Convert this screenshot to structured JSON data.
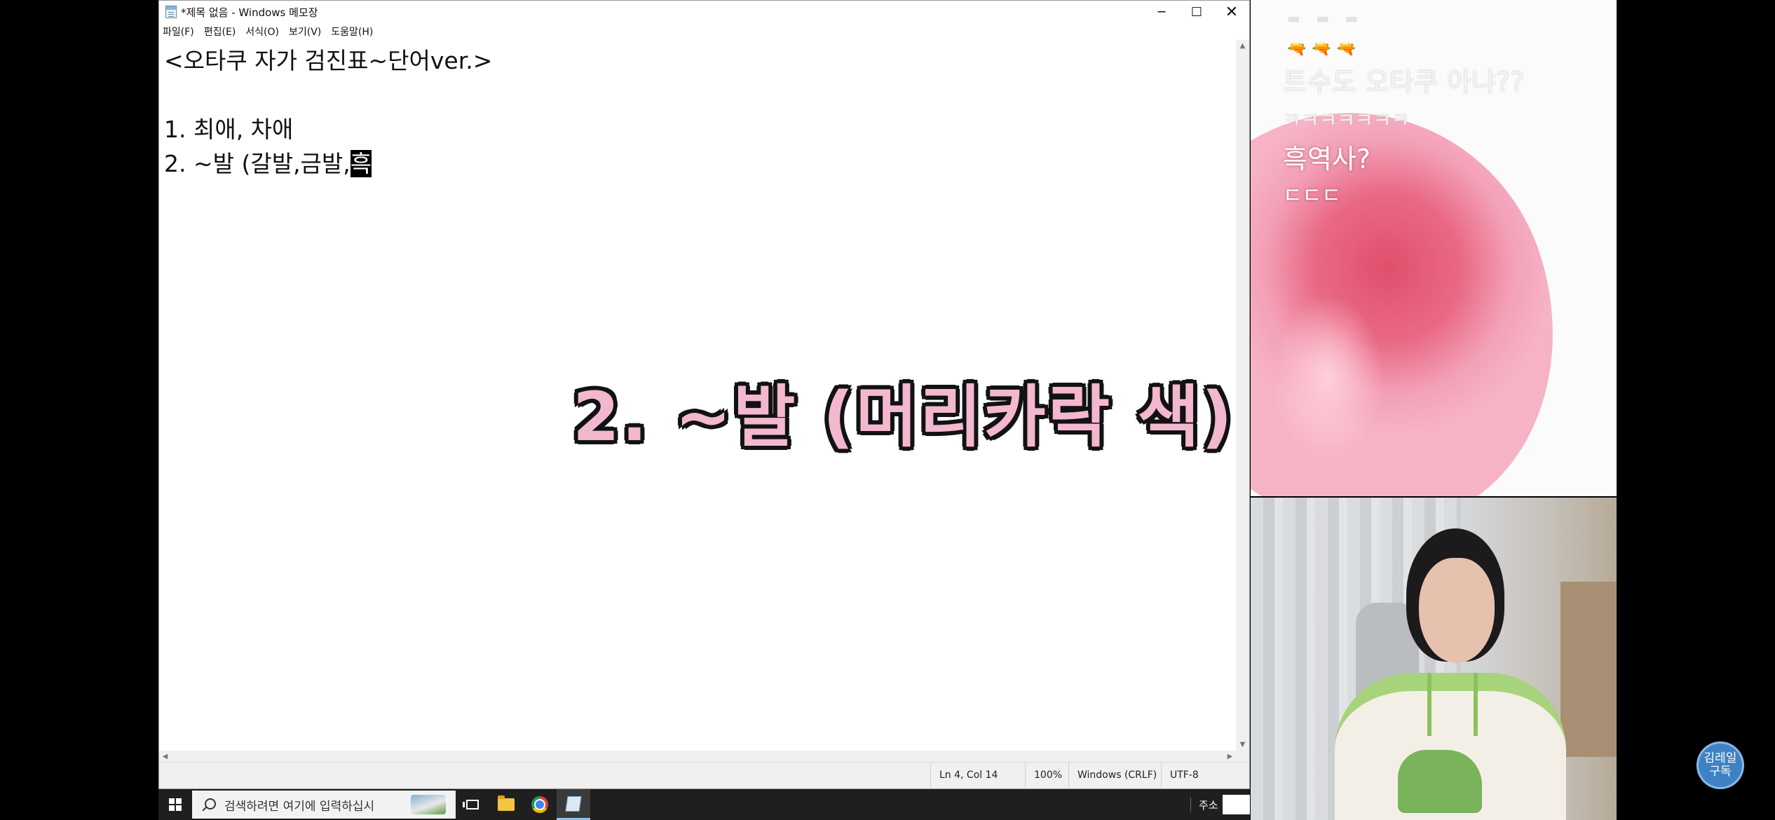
{
  "notepad": {
    "title": "*제목 없음 - Windows 메모장",
    "controls": {
      "minimize": "─",
      "maximize": "☐",
      "close": "✕"
    },
    "menu": [
      "파일(F)",
      "편집(E)",
      "서식(O)",
      "보기(V)",
      "도움말(H)"
    ],
    "editor": {
      "line1": "<오타쿠 자가 검진표~단어ver.>",
      "line3": "1. 최애, 차애",
      "line4_text": "2. ~발 (갈발,금발,",
      "line4_selected": "흑"
    },
    "overlay_caption": "2. ~발 (머리카락 색)",
    "status": {
      "position": "Ln 4, Col 14",
      "zoom": "100%",
      "line_ending": "Windows (CRLF)",
      "encoding": "UTF-8"
    }
  },
  "taskbar": {
    "search_placeholder": "검색하려면 여기에 입력하십시",
    "tray_label": "주소"
  },
  "chat": {
    "reactions_faded": "▬ ▬ ▬",
    "reactions": "🔫🔫🔫",
    "messages": [
      "트수도 오타쿠 아냐??",
      "ㅋㅋㅋㅋㅋㅋㅋ",
      "흑역사?",
      "ㄷㄷㄷ"
    ]
  },
  "subscribe_badge": {
    "line1": "김레일",
    "line2": "구독"
  }
}
